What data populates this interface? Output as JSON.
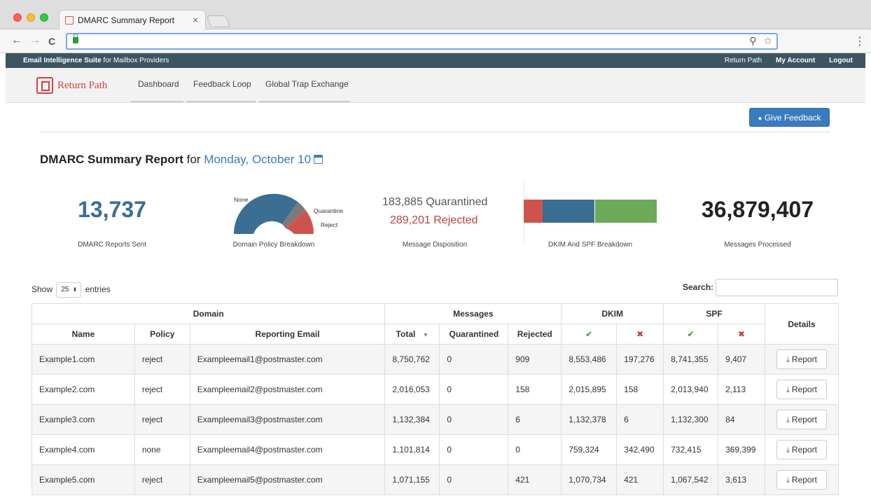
{
  "browser": {
    "tab_title": "DMARC Summary Report",
    "tab_close": "×",
    "back_icon": "←",
    "forward_icon": "→",
    "reload_icon": "C",
    "search_icon": "⚲",
    "star_icon": "☆",
    "menu_icon": "⋮"
  },
  "topbar": {
    "suite_bold": "Email Intelligence Suite",
    "suite_rest": " for Mailbox Providers",
    "links": [
      "Return Path",
      "My Account",
      "Logout"
    ]
  },
  "nav": {
    "logo_text": "Return Path",
    "items": [
      "Dashboard",
      "Feedback Loop",
      "Global Trap Exchange"
    ]
  },
  "feedback_button": "Give Feedback",
  "title": {
    "main": "DMARC Summary Report",
    "for": "for",
    "date": "Monday, October 10"
  },
  "stats": {
    "reports_sent": {
      "value": "13,737",
      "label": "DMARC Reports Sent"
    },
    "policy": {
      "label": "Domain Policy Breakdown",
      "legend": [
        "None",
        "Quarantine",
        "Reject"
      ],
      "colors": {
        "none": "#3a6e92",
        "quarantine": "#7a7a7a",
        "reject": "#cf534d"
      }
    },
    "disposition": {
      "quarantined": "183,885",
      "quarantined_label": "Quarantined",
      "rejected": "289,201",
      "rejected_label": "Rejected",
      "label": "Message Disposition"
    },
    "dkim_spf": {
      "label": "DKIM And SPF Breakdown",
      "colors": [
        "#cf534d",
        "#3a6e92",
        "#6aaa58"
      ]
    },
    "processed": {
      "value": "36,879,407",
      "label": "Messages Processed"
    }
  },
  "table_controls": {
    "show": "Show",
    "entries_value": "25",
    "entries": "entries",
    "search": "Search:"
  },
  "table": {
    "groups": [
      "Domain",
      "Messages",
      "DKIM",
      "SPF",
      "Details"
    ],
    "columns": [
      "Name",
      "Policy",
      "Reporting Email",
      "Total",
      "Quarantined",
      "Rejected"
    ],
    "check": "✔",
    "cross": "✖",
    "report_label": "Report",
    "rows": [
      [
        "Example1.com",
        "reject",
        "Exampleemail1@postmaster.com",
        "8,750,762",
        "0",
        "909",
        "8,553,486",
        "197,276",
        "8,741,355",
        "9,407"
      ],
      [
        "Example2.com",
        "reject",
        "Exampleemail2@postmaster.com",
        "2,016,053",
        "0",
        "158",
        "2,015,895",
        "158",
        "2,013,940",
        "2,113"
      ],
      [
        "Example3.com",
        "reject",
        "Exampleemail3@postmaster.com",
        "1,132,384",
        "0",
        "6",
        "1,132,378",
        "6",
        "1,132,300",
        "84"
      ],
      [
        "Example4.com",
        "none",
        "Exampleemail4@postmaster.com",
        "1,101,814",
        "0",
        "0",
        "759,324",
        "342,490",
        "732,415",
        "369,399"
      ],
      [
        "Example5.com",
        "reject",
        "Exampleemail5@postmaster.com",
        "1,071,155",
        "0",
        "421",
        "1,070,734",
        "421",
        "1,067,542",
        "3,613"
      ]
    ]
  }
}
